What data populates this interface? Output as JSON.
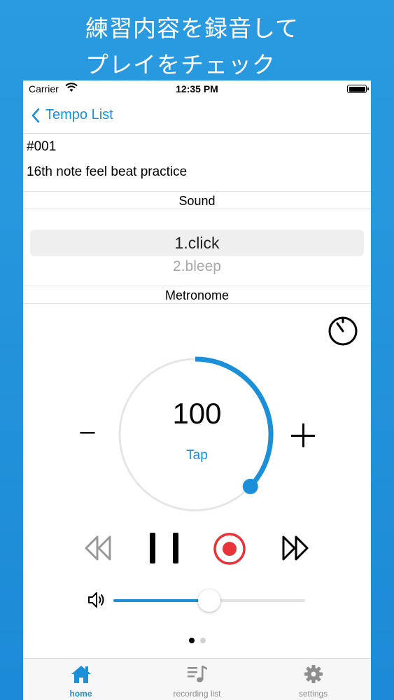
{
  "promo": {
    "line1": "練習内容を録音して",
    "line2": "プレイをチェック"
  },
  "status_bar": {
    "carrier": "Carrier",
    "time": "12:35 PM"
  },
  "nav": {
    "back_label": "Tempo List"
  },
  "tempo_item": {
    "number": "#001",
    "title": "16th note feel beat practice"
  },
  "sound": {
    "header": "Sound",
    "options": [
      "1.click",
      "2.bleep"
    ],
    "selected": "1.click"
  },
  "metronome": {
    "header": "Metronome",
    "bpm": "100",
    "tap_label": "Tap",
    "minus_label": "–",
    "dial_progress": 0.37
  },
  "volume": {
    "level": 0.5
  },
  "pager": {
    "count": 2,
    "active": 0
  },
  "tabbar": {
    "items": [
      {
        "label": "home",
        "icon": "home-icon",
        "active": true
      },
      {
        "label": "recording list",
        "icon": "music-list-icon",
        "active": false
      },
      {
        "label": "settings",
        "icon": "gear-icon",
        "active": false
      }
    ]
  },
  "colors": {
    "accent": "#1b90d9",
    "record": "#e8333a",
    "background": "#2a9be0"
  }
}
